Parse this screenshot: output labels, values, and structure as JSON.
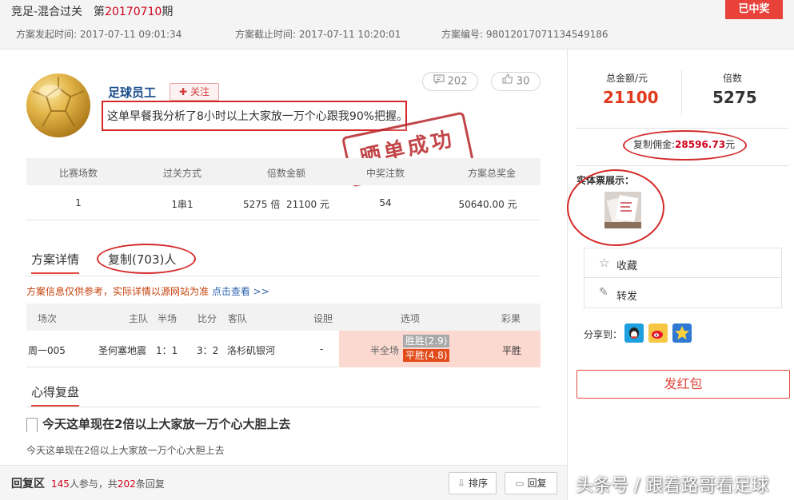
{
  "header": {
    "title_prefix": "竞足-混合过关　第",
    "period": "20170710",
    "title_suffix": "期",
    "start_time_label": "方案发起时间:",
    "start_time": "2017-07-11 09:01:34",
    "end_time_label": "方案截止时间:",
    "end_time": "2017-07-11 10:20:01",
    "plan_no_label": "方案编号:",
    "plan_no": "98012017071134549186",
    "status_badge": "已中奖"
  },
  "author": {
    "name": "足球员工",
    "follow_label": "关注",
    "comments": "202",
    "likes": "30",
    "description": "这单早餐我分析了8小时以上大家放一万个心跟我90%把握。",
    "stamp_text": "晒单成功"
  },
  "summary": {
    "headers": [
      "比赛场数",
      "过关方式",
      "倍数金额",
      "中奖注数",
      "方案总奖金"
    ],
    "row": {
      "matches": "1",
      "pass_type": "1串1",
      "multiple_amount": "5275 倍  21100 元",
      "winning_bets": "54",
      "total_prize": "50640.00 元"
    }
  },
  "tabs": {
    "detail": "方案详情",
    "copy": "复制(703)人"
  },
  "notice": {
    "text": "方案信息仅供参考，实际详情以源网站为准 ",
    "link": "点击查看 >>"
  },
  "match_table": {
    "headers": {
      "round": "场次",
      "home": "主队",
      "half": "半场",
      "score": "比分",
      "away": "客队",
      "handicap": "设胆",
      "options": "选项",
      "result": "彩果"
    },
    "row": {
      "round": "周一005",
      "home": "圣何塞地震",
      "half": "1：1",
      "score": "3：2",
      "away": "洛杉矶银河",
      "handicap": "-",
      "option_type": "半全场",
      "option1": "胜胜(2.9)",
      "option2": "平胜(4.8)",
      "result": "平胜"
    }
  },
  "review": {
    "section_title": "心得复盘",
    "post_title": "今天这单现在2倍以上大家放一万个心大胆上去",
    "post_body": "今天这单现在2倍以上大家放一万个心大胆上去"
  },
  "reply": {
    "label": "回复区",
    "participants": "145",
    "participants_suffix": "人参与，共",
    "replies": "202",
    "replies_suffix": "条回复",
    "sort_label": "排序",
    "reply_label": "回复"
  },
  "sidebar": {
    "total_label": "总金额/元",
    "total_value": "21100",
    "multiple_label": "倍数",
    "multiple_value": "5275",
    "commission_label": "复制佣金:",
    "commission_value": "28596.73",
    "commission_unit": "元",
    "ticket_label": "实体票展示：",
    "collect_label": "收藏",
    "forward_label": "转发",
    "share_label": "分享到：",
    "redpack_label": "发红包"
  },
  "watermark": "头条号 / 跟着路哥看足球",
  "colors": {
    "accent_red": "#e0391b",
    "link_blue": "#2e63ad",
    "badge_red": "#e8423b",
    "selection_bg": "#fbd9d1"
  }
}
